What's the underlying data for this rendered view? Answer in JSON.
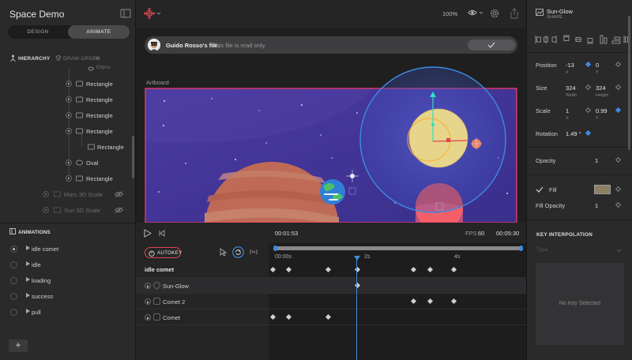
{
  "app": {
    "title": "Space Demo"
  },
  "mode": {
    "design": "DESIGN",
    "animate": "ANIMATE"
  },
  "hierarchy": {
    "label": "HIERARCHY",
    "draw_order_label": "DRAW ORDER",
    "items": [
      {
        "label": "Ellipse"
      },
      {
        "label": "Rectangle"
      },
      {
        "label": "Rectangle"
      },
      {
        "label": "Rectangle"
      },
      {
        "label": "Rectangle"
      },
      {
        "label": "Rectangle"
      },
      {
        "label": "Oval"
      },
      {
        "label": "Rectangle"
      },
      {
        "label": "Mars 3D Scale"
      },
      {
        "label": "Sun 3D Scale"
      }
    ]
  },
  "animations": {
    "label": "ANIMATIONS",
    "items": [
      {
        "label": "idle comet"
      },
      {
        "label": "idle"
      },
      {
        "label": "loading"
      },
      {
        "label": "success"
      },
      {
        "label": "pull"
      }
    ],
    "add_label": "+"
  },
  "toolbar": {
    "zoom": "100%"
  },
  "banner": {
    "owner": "Guido Rosso's file.",
    "note": "This file is read only."
  },
  "stage": {
    "artboard_label": "Artboard"
  },
  "timeline": {
    "current_time": "00:01:53",
    "fps_label": "FPS",
    "fps_value": "60",
    "total_time": "00:05:30",
    "autokey": "AUTOKEY",
    "animation_name": "idle comet",
    "ticks": [
      "00:00s",
      "2s",
      "4s"
    ],
    "tracks": [
      {
        "label": "Sun-Glow"
      },
      {
        "label": "Comet 2"
      },
      {
        "label": "Comet"
      }
    ]
  },
  "inspector": {
    "name": "Sun-Glow",
    "type": "SHAPE",
    "position": {
      "label": "Position",
      "x": "-13",
      "y": "0",
      "x_sub": "X",
      "y_sub": "Y"
    },
    "size": {
      "label": "Size",
      "w": "324",
      "h": "324",
      "w_sub": "Width",
      "h_sub": "Height"
    },
    "scale": {
      "label": "Scale",
      "x": "1",
      "y": "0.99",
      "x_sub": "X",
      "y_sub": "Y"
    },
    "rotation": {
      "label": "Rotation",
      "value": "1.49 °"
    },
    "opacity": {
      "label": "Opacity",
      "value": "1"
    },
    "fill": {
      "label": "Fill",
      "color": "#8c8161"
    },
    "fill_opacity": {
      "label": "Fill Opacity",
      "value": "1"
    },
    "key_interpolation": {
      "label": "KEY INTERPOLATION",
      "type_label": "Type",
      "empty": "No Key Selected"
    }
  },
  "colors": {
    "accent": "#3d8be0",
    "autokey": "#e0454f",
    "sky": "#4a3a9a",
    "planet": "#e8826a",
    "sun": "#e6d58a",
    "mars": "#e35050"
  }
}
